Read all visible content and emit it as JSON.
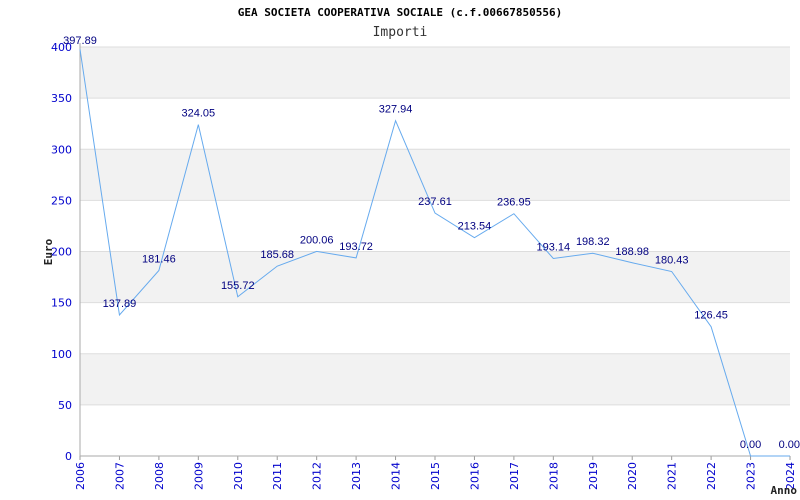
{
  "title": "GEA SOCIETA COOPERATIVA SOCIALE (c.f.00667850556)",
  "subtitle": "Importi",
  "chart_data": {
    "type": "line",
    "title": "GEA SOCIETA COOPERATIVA SOCIALE (c.f.00667850556)",
    "subtitle": "Importi",
    "xlabel": "Anno",
    "ylabel": "Euro",
    "ylim": [
      0,
      400
    ],
    "y_ticks": [
      0,
      50,
      100,
      150,
      200,
      250,
      300,
      350,
      400
    ],
    "grid": true,
    "line_color": "#66aaee",
    "x": [
      "2006",
      "2007",
      "2008",
      "2009",
      "2010",
      "2011",
      "2012",
      "2013",
      "2014",
      "2015",
      "2016",
      "2017",
      "2018",
      "2019",
      "2020",
      "2021",
      "2022",
      "2023",
      "2024"
    ],
    "values": [
      397.89,
      137.89,
      181.46,
      324.05,
      155.72,
      185.68,
      200.06,
      193.72,
      327.94,
      237.61,
      213.54,
      236.95,
      193.14,
      198.32,
      188.98,
      180.43,
      126.45,
      0.0,
      0.0
    ],
    "data_labels": [
      "397.89",
      "137.89",
      "181.46",
      "324.05",
      "155.72",
      "185.68",
      "200.06",
      "193.72",
      "327.94",
      "237.61",
      "213.54",
      "236.95",
      "193.14",
      "198.32",
      "188.98",
      "180.43",
      "126.45",
      "0.00",
      "0.00"
    ]
  }
}
